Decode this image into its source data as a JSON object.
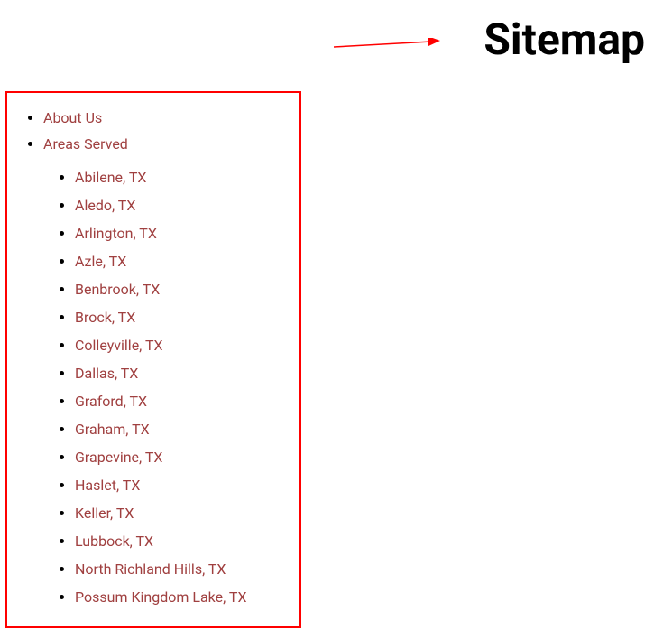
{
  "title": "Sitemap",
  "links": {
    "about": "About Us",
    "areas_served": "Areas Served"
  },
  "areas": [
    "Abilene, TX",
    "Aledo, TX",
    "Arlington, TX",
    "Azle, TX",
    "Benbrook, TX",
    "Brock, TX",
    "Colleyville, TX",
    "Dallas, TX",
    "Graford, TX",
    "Graham, TX",
    "Grapevine, TX",
    "Haslet, TX",
    "Keller, TX",
    "Lubbock, TX",
    "North Richland Hills, TX",
    "Possum Kingdom Lake, TX"
  ],
  "colors": {
    "annotation": "#ff0000",
    "link": "#a04040"
  }
}
